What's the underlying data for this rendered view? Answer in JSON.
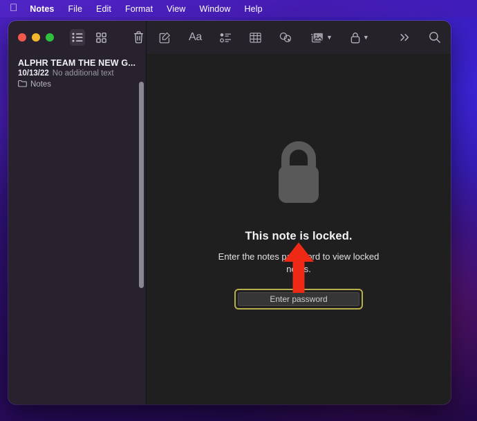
{
  "menubar": {
    "apple_glyph": "",
    "items": [
      {
        "label": "Notes",
        "bold": true
      },
      {
        "label": "File",
        "bold": false
      },
      {
        "label": "Edit",
        "bold": false
      },
      {
        "label": "Format",
        "bold": false
      },
      {
        "label": "View",
        "bold": false
      },
      {
        "label": "Window",
        "bold": false
      },
      {
        "label": "Help",
        "bold": false
      }
    ]
  },
  "window": {
    "app": "Notes",
    "traffic_lights": {
      "close_color": "#f2584c",
      "minimize_color": "#f3b72d",
      "zoom_color": "#2fc03e"
    }
  },
  "sidebar": {
    "toolbar_icons": [
      {
        "name": "list-view-icon",
        "active": true
      },
      {
        "name": "gallery-view-icon",
        "active": false
      },
      {
        "name": "delete-note-icon",
        "active": false
      }
    ],
    "notes": [
      {
        "title": "ALPHR TEAM THE NEW G...",
        "date": "10/13/22",
        "snippet": "No additional text",
        "folder": "Notes"
      }
    ]
  },
  "main_toolbar": {
    "icons": [
      {
        "name": "compose-note-icon",
        "label": "",
        "chevron": false
      },
      {
        "name": "format-text-icon",
        "label": "Aa",
        "chevron": false
      },
      {
        "name": "checklist-icon",
        "label": "",
        "chevron": false
      },
      {
        "name": "table-icon",
        "label": "",
        "chevron": false
      },
      {
        "name": "link-icon",
        "label": "",
        "chevron": false
      },
      {
        "name": "media-icon",
        "label": "",
        "chevron": true
      },
      {
        "name": "lock-icon",
        "label": "",
        "chevron": true
      },
      {
        "name": "more-options-icon",
        "label": "»",
        "chevron": false
      },
      {
        "name": "search-icon",
        "label": "",
        "chevron": false
      }
    ]
  },
  "locked_note": {
    "title": "This note is locked.",
    "description": "Enter the notes password to view locked notes.",
    "button_label": "Enter password",
    "highlight_color": "#b9ae4c",
    "arrow_color": "#ee2a16",
    "lock_icon_color": "#595959"
  }
}
